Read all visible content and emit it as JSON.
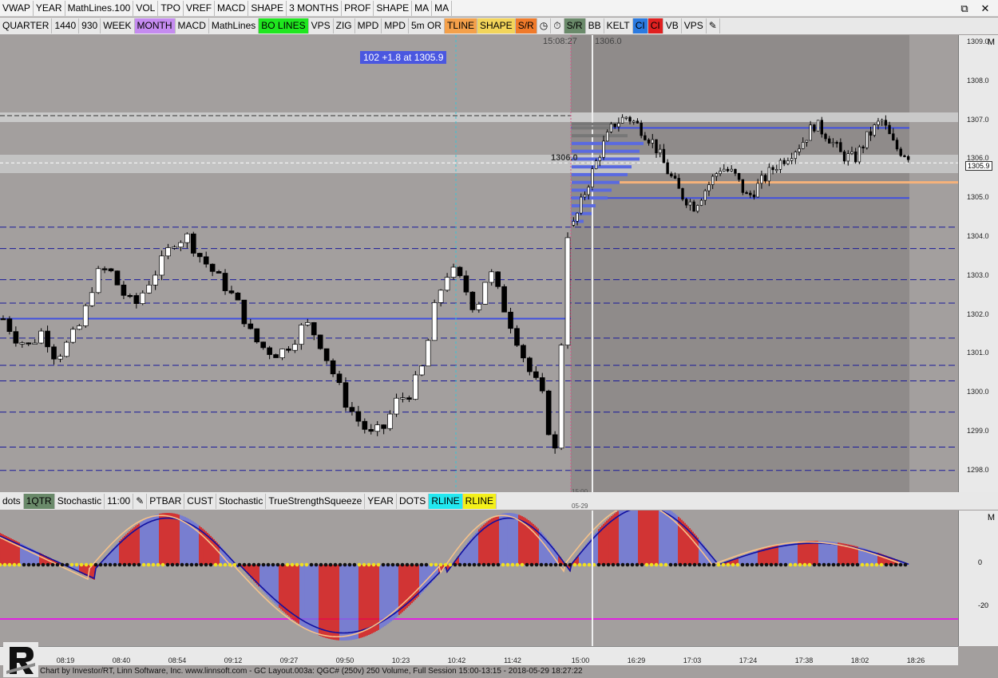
{
  "toolbar1": [
    "VWAP",
    "YEAR",
    "MathLines.100",
    "VOL",
    "TPO",
    "VREF",
    "MACD",
    "SHAPE",
    "3 MONTHS",
    "PROF",
    "SHAPE",
    "MA",
    "MA"
  ],
  "toolbar2": [
    {
      "label": "QUARTER",
      "bg": "#e8e8e8"
    },
    {
      "label": "1440",
      "bg": "#e8e8e8"
    },
    {
      "label": "930",
      "bg": "#e8e8e8"
    },
    {
      "label": "WEEK",
      "bg": "#e8e8e8"
    },
    {
      "label": "MONTH",
      "bg": "#c58bf0"
    },
    {
      "label": "MACD",
      "bg": "#e8e8e8"
    },
    {
      "label": "MathLines",
      "bg": "#e8e8e8"
    },
    {
      "label": "BO LINES",
      "bg": "#1fe61f"
    },
    {
      "label": "VPS",
      "bg": "#e8e8e8"
    },
    {
      "label": "ZIG",
      "bg": "#e8e8e8"
    },
    {
      "label": "MPD",
      "bg": "#e8e8e8"
    },
    {
      "label": "MPD",
      "bg": "#e8e8e8"
    },
    {
      "label": "5m OR",
      "bg": "#e8e8e8"
    },
    {
      "label": "TLINE",
      "bg": "#f4a04a"
    },
    {
      "label": "SHAPE",
      "bg": "#f3d55a"
    },
    {
      "label": "S/R",
      "bg": "#f07a2a"
    },
    {
      "label": "◷",
      "bg": "#e8e8e8"
    },
    {
      "label": "⏱",
      "bg": "#e8e8e8"
    },
    {
      "label": "S/R",
      "bg": "#6a8a6a"
    },
    {
      "label": "BB",
      "bg": "#e8e8e8"
    },
    {
      "label": "KELT",
      "bg": "#e8e8e8"
    },
    {
      "label": "CI",
      "bg": "#2a7ae0"
    },
    {
      "label": "CI",
      "bg": "#e02020"
    },
    {
      "label": "VB",
      "bg": "#e8e8e8"
    },
    {
      "label": "VPS",
      "bg": "#e8e8e8"
    },
    {
      "label": "✎",
      "bg": "#e8e8e8"
    }
  ],
  "indicator_bar": [
    {
      "label": "dots",
      "bg": "#e8e8e8"
    },
    {
      "label": "1QTR",
      "bg": "#6a8a6a"
    },
    {
      "label": "Stochastic",
      "bg": "#e8e8e8"
    },
    {
      "label": "11:00",
      "bg": "#e8e8e8"
    },
    {
      "label": "✎",
      "bg": "#e8e8e8"
    },
    {
      "label": "PTBAR",
      "bg": "#e8e8e8"
    },
    {
      "label": "CUST",
      "bg": "#e8e8e8"
    },
    {
      "label": "Stochastic",
      "bg": "#e8e8e8"
    },
    {
      "label": "TrueStrengthSqueeze",
      "bg": "#e8e8e8"
    },
    {
      "label": "YEAR",
      "bg": "#e8e8e8"
    },
    {
      "label": "DOTS",
      "bg": "#e8e8e8"
    },
    {
      "label": "RLINE",
      "bg": "#22e8f0"
    },
    {
      "label": "RLINE",
      "bg": "#f4f01a"
    }
  ],
  "window_controls": [
    "⧉",
    "✕"
  ],
  "chart": {
    "price_ticks": [
      "1309.0",
      "1308.0",
      "1307.0",
      "1306.0",
      "1305.0",
      "1304.0",
      "1303.0",
      "1302.0",
      "1301.0",
      "1300.0",
      "1299.0",
      "1298.0"
    ],
    "time_ticks": [
      "08:19",
      "08:40",
      "08:54",
      "09:12",
      "09:27",
      "09:50",
      "10:23",
      "10:42",
      "11:42",
      "15:00",
      "16:29",
      "17:03",
      "17:24",
      "17:38",
      "18:02",
      "18:26"
    ],
    "price_label": "102  +1.8 at 1305.9",
    "cursor_time": "15:08:27",
    "cursor_price": "1306.0",
    "vp_label": "1306.0",
    "last_price": "1305.9",
    "session_time": "15:00",
    "session_date": "05-29"
  },
  "indicator": {
    "axis_m": "M",
    "ticks": [
      "0",
      "-20"
    ]
  },
  "axis_m": "M",
  "status_text": "Chart by Investor/RT, Linn Software, Inc. www.linnsoft.com - GC Layout.003a: QGC# (250v) 250 Volume, Full Session 15:00-13:15 - 2018-05-29 18:27:22"
}
